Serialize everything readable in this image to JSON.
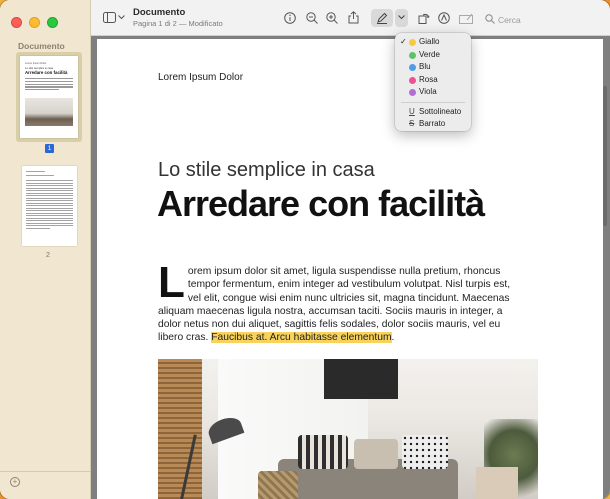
{
  "window": {
    "title": "Documento",
    "subtitle": "Pagina 1 di 2 — Modificato"
  },
  "sidebar": {
    "title": "Documento",
    "pages": [
      {
        "number": "1",
        "selected": true
      },
      {
        "number": "2",
        "selected": false
      }
    ],
    "thumbnail_1": {
      "header": "Lorem Ipsum Dolor",
      "subtitle": "Lo stile semplice in casa",
      "title": "Arredare con facilità"
    }
  },
  "toolbar": {
    "search_placeholder": "Cerca",
    "icons": [
      "sidebar-icon",
      "chevron-down-icon",
      "info-icon",
      "zoom-out-icon",
      "zoom-in-icon",
      "share-icon",
      "highlight-pen-icon",
      "chevron-down-icon",
      "rotate-icon",
      "markup-icon",
      "form-icon",
      "search-icon"
    ]
  },
  "highlight_menu": {
    "items": [
      {
        "label": "Giallo",
        "color": "#f5c948",
        "checked": true
      },
      {
        "label": "Verde",
        "color": "#5fc26a",
        "checked": false
      },
      {
        "label": "Blu",
        "color": "#4f9dea",
        "checked": false
      },
      {
        "label": "Rosa",
        "color": "#e9538f",
        "checked": false
      },
      {
        "label": "Viola",
        "color": "#b16fd6",
        "checked": false
      }
    ],
    "styles": [
      {
        "label": "Sottolineato",
        "glyph": "U"
      },
      {
        "label": "Barrato",
        "glyph": "S"
      }
    ]
  },
  "document": {
    "header": "Lorem Ipsum Dolor",
    "subtitle": "Lo stile semplice in casa",
    "title": "Arredare con facilità",
    "dropcap": "L",
    "body": "orem ipsum dolor sit amet, ligula suspendisse nulla pretium, rhoncus tempor fermentum, enim integer ad vestibulum volutpat. Nisl turpis est, vel elit, congue wisi enim nunc ultricies sit, magna tincidunt. Maecenas aliquam maecenas ligula nostra, accumsan taciti. Sociis mauris in integer, a dolor netus non dui aliquet, sagittis felis sodales, dolor sociis mauris, vel eu libero cras. ",
    "highlighted": "Faucibus at. Arcu habitasse elementum",
    "after_highlight": ".",
    "highlight_color": "#f8d25a"
  }
}
